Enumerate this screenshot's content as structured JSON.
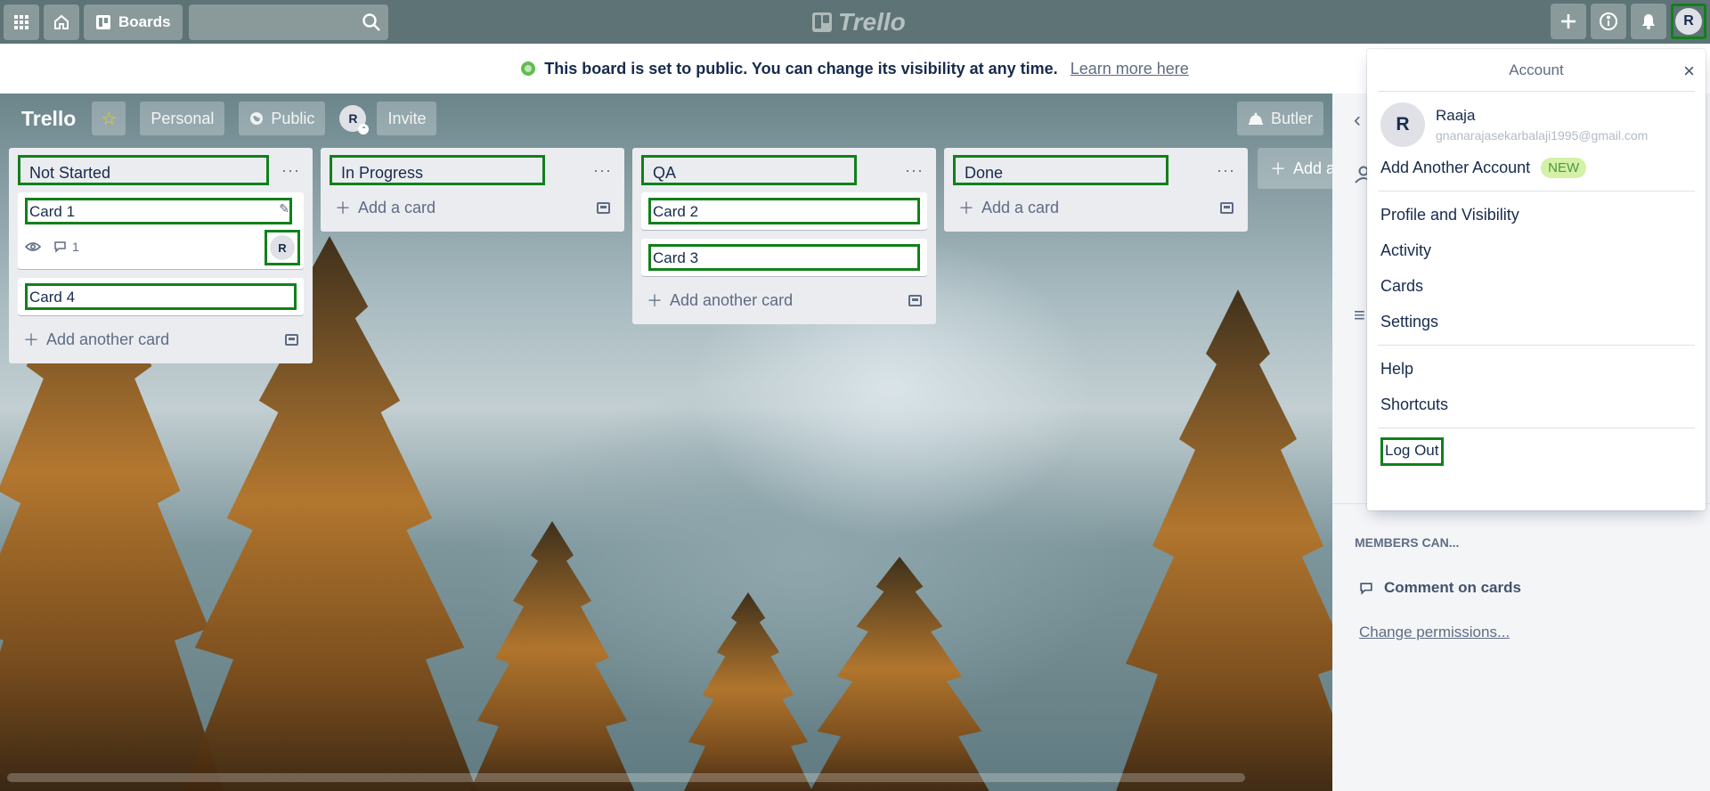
{
  "header": {
    "boards_label": "Boards",
    "logo_text": "Trello",
    "avatar_initial": "R",
    "icons": [
      "apps-icon",
      "home-icon",
      "boards-icon",
      "search-icon",
      "plus-icon",
      "info-icon",
      "bell-icon"
    ]
  },
  "banner": {
    "text": "This board is set to public. You can change its visibility at any time.",
    "link": "Learn more here"
  },
  "board": {
    "title": "Trello",
    "team": "Personal",
    "visibility": "Public",
    "member_initial": "R",
    "invite": "Invite",
    "butler": "Butler",
    "add_list": "Add a",
    "lists": [
      {
        "name": "Not Started",
        "menu": "···",
        "cards": [
          {
            "title": "Card 1",
            "comments": "1",
            "member": "R"
          },
          {
            "title": "Card 4"
          }
        ],
        "add_label": "Add another card"
      },
      {
        "name": "In Progress",
        "menu": "···",
        "cards": [],
        "add_label": "Add a card"
      },
      {
        "name": "QA",
        "menu": "···",
        "cards": [
          {
            "title": "Card 2"
          },
          {
            "title": "Card 3"
          }
        ],
        "add_label": "Add another card"
      },
      {
        "name": "Done",
        "menu": "···",
        "cards": [],
        "add_label": "Add a card"
      }
    ]
  },
  "sidebar": {
    "section_title": "MEMBERS CAN...",
    "permission_item": "Comment on cards",
    "change_link": "Change permissions..."
  },
  "account_menu": {
    "title": "Account",
    "close": "×",
    "avatar_initial": "R",
    "name": "Raaja",
    "email": "gnanarajasekarbalaji1995@gmail.com",
    "add_account": "Add Another Account",
    "new_badge": "NEW",
    "items_group1": [
      "Profile and Visibility",
      "Activity",
      "Cards",
      "Settings"
    ],
    "items_group2": [
      "Help",
      "Shortcuts"
    ],
    "logout": "Log Out"
  }
}
